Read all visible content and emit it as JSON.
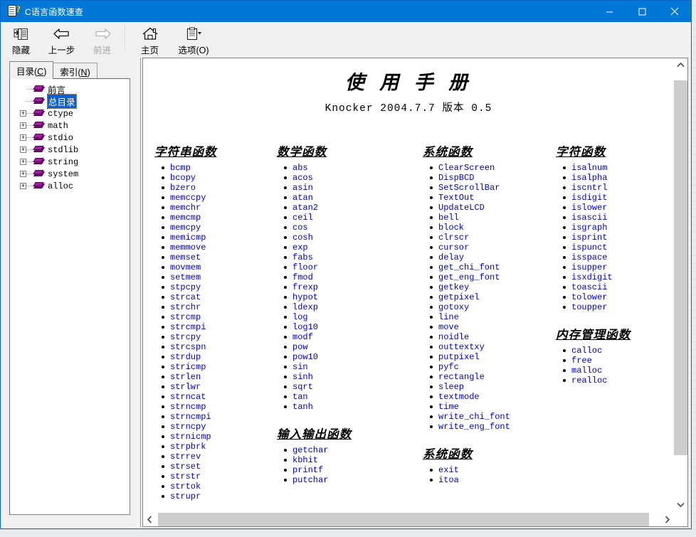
{
  "window": {
    "title": "C语言函数速查",
    "icon": "help-book-icon",
    "caption": {
      "minimize": "minimize-icon",
      "maximize": "maximize-icon",
      "close": "close-icon"
    }
  },
  "toolbar": {
    "items": [
      {
        "label": "隐藏",
        "icon": "hide-pane-icon",
        "disabled": false
      },
      {
        "label": "上一步",
        "icon": "back-arrow-icon",
        "disabled": false
      },
      {
        "label": "前进",
        "icon": "forward-arrow-icon",
        "disabled": true
      },
      {
        "label": "主页",
        "icon": "home-icon",
        "disabled": false
      },
      {
        "label": "选项(O)",
        "icon": "options-icon",
        "disabled": false
      }
    ]
  },
  "sidebar": {
    "tabs": [
      {
        "label": "目录(C)",
        "active": true
      },
      {
        "label": "索引(N)",
        "active": false
      }
    ],
    "tree": [
      {
        "label": "前言",
        "expandable": false,
        "selected": false,
        "cjk": true
      },
      {
        "label": "总目录",
        "expandable": false,
        "selected": true,
        "cjk": true
      },
      {
        "label": "ctype",
        "expandable": true,
        "selected": false,
        "cjk": false
      },
      {
        "label": "math",
        "expandable": true,
        "selected": false,
        "cjk": false
      },
      {
        "label": "stdio",
        "expandable": true,
        "selected": false,
        "cjk": false
      },
      {
        "label": "stdlib",
        "expandable": true,
        "selected": false,
        "cjk": false
      },
      {
        "label": "string",
        "expandable": true,
        "selected": false,
        "cjk": false
      },
      {
        "label": "system",
        "expandable": true,
        "selected": false,
        "cjk": false
      },
      {
        "label": "alloc",
        "expandable": true,
        "selected": false,
        "cjk": false
      }
    ],
    "expander_symbol": "+"
  },
  "document": {
    "title": "使 用 手 册",
    "subtitle": "Knocker 2004.7.7 版本 0.5",
    "columns": [
      {
        "sections": [
          {
            "heading": "字符串函数",
            "functions": [
              "bcmp",
              "bcopy",
              "bzero",
              "memccpy",
              "memchr",
              "memcmp",
              "memcpy",
              "memicmp",
              "memmove",
              "memset",
              "movmem",
              "setmem",
              "stpcpy",
              "strcat",
              "strchr",
              "strcmp",
              "strcmpi",
              "strcpy",
              "strcspn",
              "strdup",
              "stricmp",
              "strlen",
              "strlwr",
              "strncat",
              "strncmp",
              "strncmpi",
              "strncpy",
              "strnicmp",
              "strpbrk",
              "strrev",
              "strset",
              "strstr",
              "strtok",
              "strupr"
            ]
          }
        ]
      },
      {
        "sections": [
          {
            "heading": "数学函数",
            "functions": [
              "abs",
              "acos",
              "asin",
              "atan",
              "atan2",
              "ceil",
              "cos",
              "cosh",
              "exp",
              "fabs",
              "floor",
              "fmod",
              "frexp",
              "hypot",
              "ldexp",
              "log",
              "log10",
              "modf",
              "pow",
              "pow10",
              "sin",
              "sinh",
              "sqrt",
              "tan",
              "tanh"
            ]
          },
          {
            "heading": "输入输出函数",
            "functions": [
              "getchar",
              "kbhit",
              "printf",
              "putchar"
            ]
          }
        ]
      },
      {
        "sections": [
          {
            "heading": "系统函数",
            "functions": [
              "ClearScreen",
              "DispBCD",
              "SetScrollBar",
              "TextOut",
              "UpdateLCD",
              "bell",
              "block",
              "clrscr",
              "cursor",
              "delay",
              "get_chi_font",
              "get_eng_font",
              "getkey",
              "getpixel",
              "gotoxy",
              "line",
              "move",
              "noidle",
              "outtextxy",
              "putpixel",
              "pyfc",
              "rectangle",
              "sleep",
              "textmode",
              "time",
              "write_chi_font",
              "write_eng_font"
            ]
          },
          {
            "heading": "系统函数",
            "functions": [
              "exit",
              "itoa"
            ]
          }
        ]
      },
      {
        "sections": [
          {
            "heading": "字符函数",
            "functions": [
              "isalnum",
              "isalpha",
              "iscntrl",
              "isdigit",
              "islower",
              "isascii",
              "isgraph",
              "isprint",
              "ispunct",
              "isspace",
              "isupper",
              "isxdigit",
              "toascii",
              "tolower",
              "toupper"
            ]
          },
          {
            "heading": "内存管理函数",
            "functions": [
              "calloc",
              "free",
              "malloc",
              "realloc"
            ]
          }
        ]
      }
    ]
  },
  "scrollbars": {
    "vertical": {
      "up": "chevron-up-icon",
      "down": "chevron-down-icon"
    },
    "horizontal": {
      "left": "chevron-left-icon",
      "right": "chevron-right-icon"
    }
  },
  "colors": {
    "titlebar": "#0078d7",
    "link": "#0000cc",
    "selection": "#0a5fd4",
    "book_icon": "#800080"
  }
}
